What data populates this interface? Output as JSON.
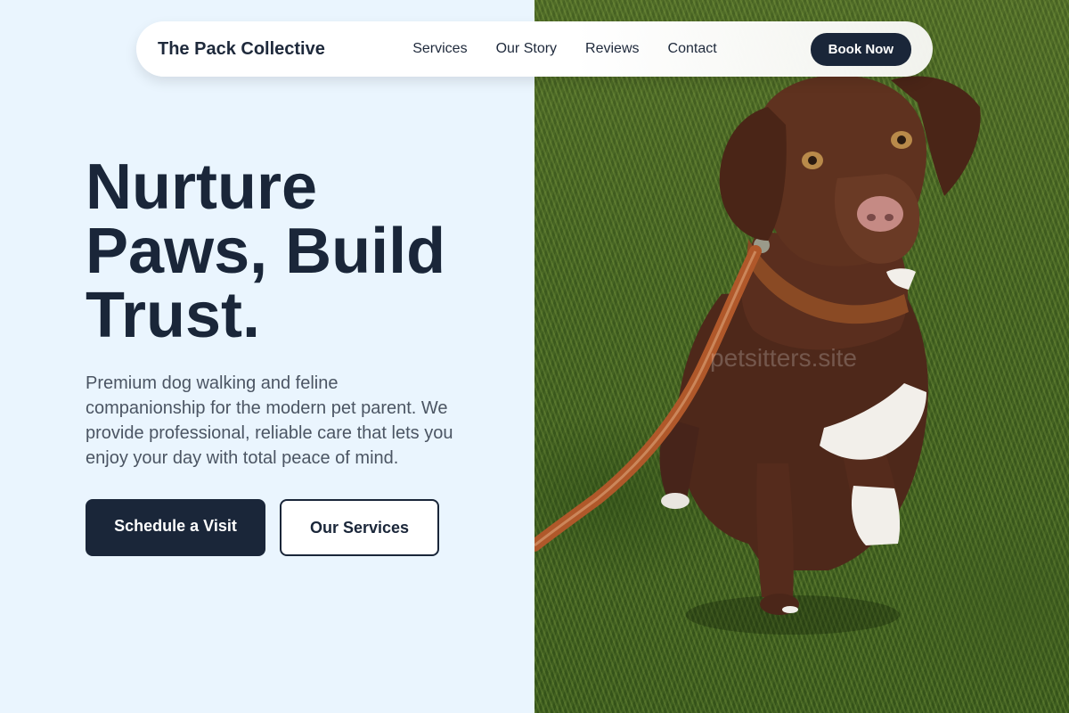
{
  "brand": {
    "name": "The Pack Collective"
  },
  "nav": {
    "links": [
      "Services",
      "Our Story",
      "Reviews",
      "Contact"
    ],
    "cta_label": "Book Now"
  },
  "hero": {
    "title_lines": [
      "Nurture",
      "Paws, Build",
      "Trust."
    ],
    "description": "Premium dog walking and feline companionship for the modern pet parent. We provide professional, reliable care that lets you enjoy your day with total peace of mind.",
    "primary_cta": "Schedule a Visit",
    "secondary_cta": "Our Services"
  },
  "photo": {
    "subject": "brown-dog-on-leash",
    "watermark": "petsitters.site"
  },
  "colors": {
    "page_background": "#eaf5fe",
    "navy": "#1a2639",
    "body_text": "#4b5563",
    "dog_coat": "#5a2e1e",
    "leash": "#b0582a"
  }
}
